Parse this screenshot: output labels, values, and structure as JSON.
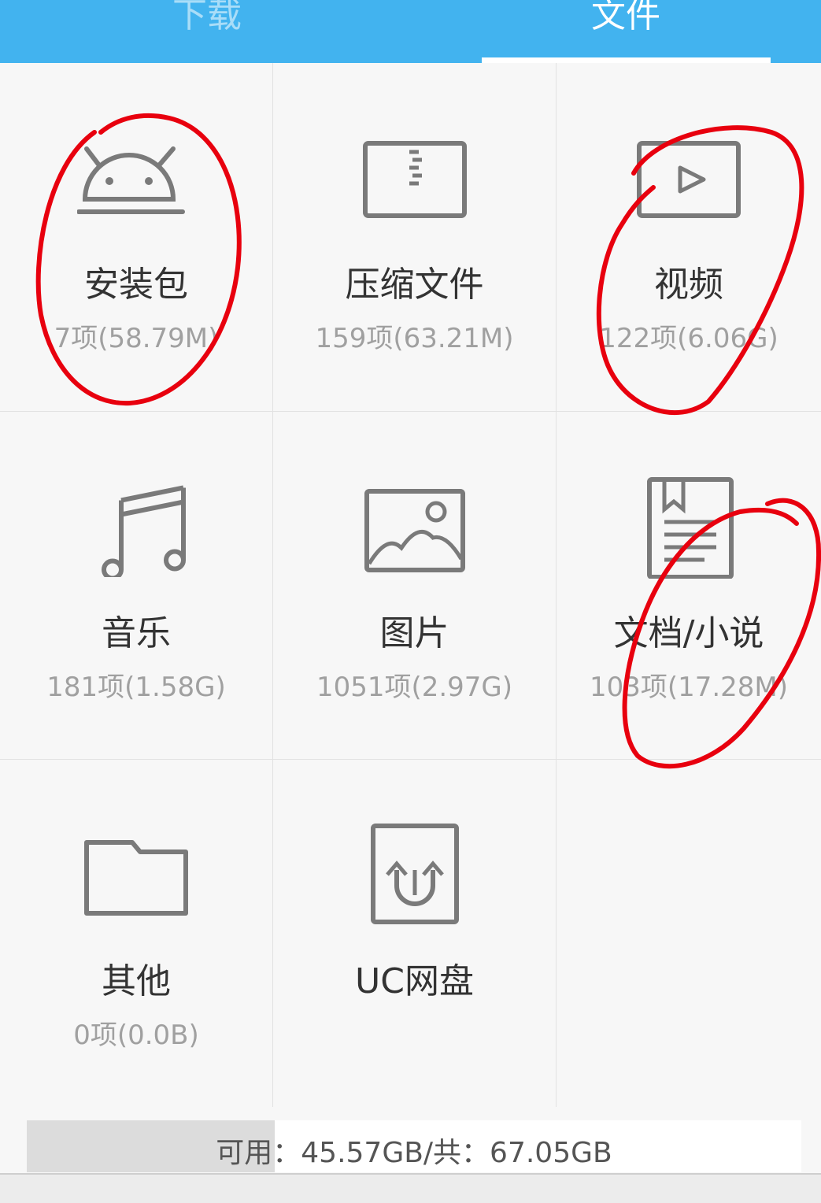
{
  "tabs": [
    {
      "label": "下载",
      "active": false
    },
    {
      "label": "文件",
      "active": true
    }
  ],
  "accent_color": "#42b3ef",
  "categories": [
    {
      "label": "安装包",
      "meta": "7项(58.79M)",
      "icon": "android-icon"
    },
    {
      "label": "压缩文件",
      "meta": "159项(63.21M)",
      "icon": "zip-icon"
    },
    {
      "label": "视频",
      "meta": "122项(6.06G)",
      "icon": "video-icon"
    },
    {
      "label": "音乐",
      "meta": "181项(1.58G)",
      "icon": "music-icon"
    },
    {
      "label": "图片",
      "meta": "1051项(2.97G)",
      "icon": "image-icon"
    },
    {
      "label": "文档/小说",
      "meta": "103项(17.28M)",
      "icon": "document-icon"
    },
    {
      "label": "其他",
      "meta": "0项(0.0B)",
      "icon": "folder-icon"
    },
    {
      "label": "UC网盘",
      "meta": "",
      "icon": "cloud-upload-icon"
    }
  ],
  "storage": {
    "text": "可用：45.57GB/共：67.05GB",
    "used_fraction": 0.32
  },
  "annotation_color": "#e8000e"
}
